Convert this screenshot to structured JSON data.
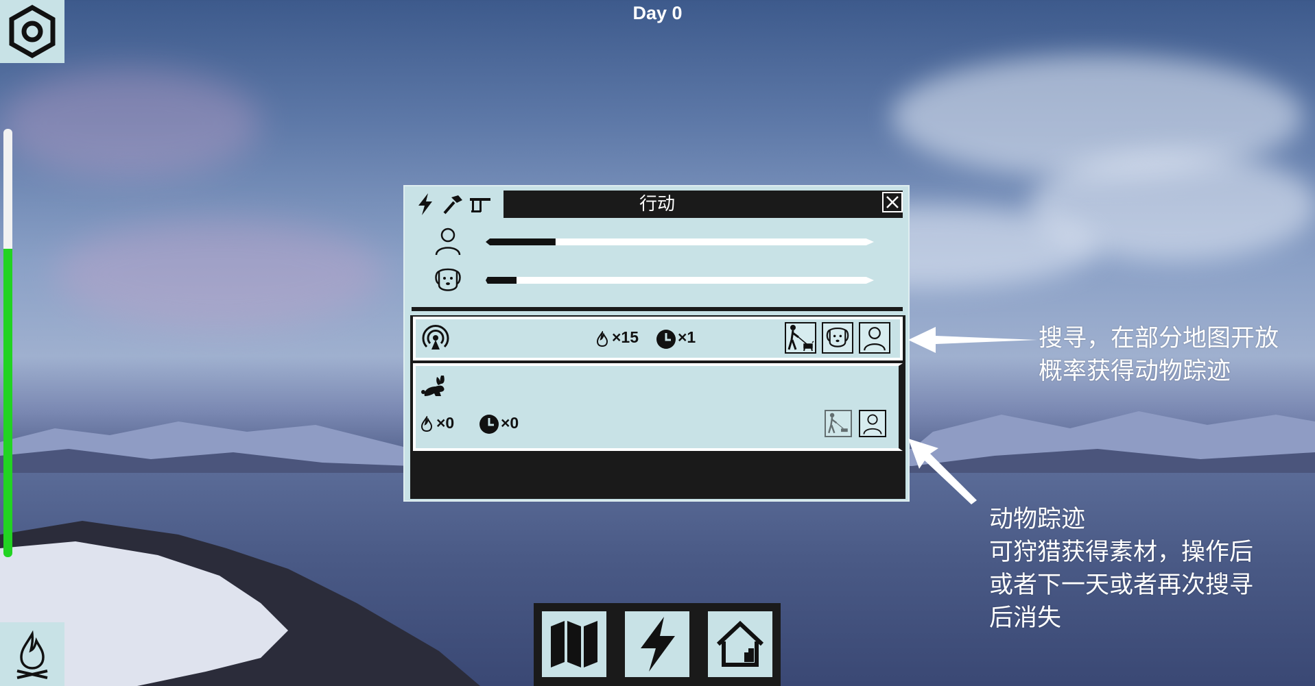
{
  "hud": {
    "day_label": "Day 0",
    "health_fraction": 0.72,
    "health_color": "#22d322"
  },
  "icons": {
    "settings": "gear-icon",
    "fire": "campfire-icon",
    "map": "map-icon",
    "action": "lightning-icon",
    "home": "home-icon"
  },
  "panel": {
    "title": "行动",
    "tabs": [
      "lightning-icon",
      "hammer-icon",
      "workbench-icon"
    ],
    "stats": [
      {
        "name": "person",
        "fill_fraction": 0.18
      },
      {
        "name": "dog",
        "fill_fraction": 0.08
      }
    ],
    "search_row": {
      "fire_cost": "×15",
      "time_cost": "×1"
    },
    "track_row": {
      "fire_cost": "×0",
      "time_cost": "×0"
    }
  },
  "annotations": {
    "search_line1": "搜寻，在部分地图开放",
    "search_line2": "概率获得动物踪迹",
    "track_line1": "动物踪迹",
    "track_line2": "可狩猎获得素材，操作后",
    "track_line3": "或者下一天或者再次搜寻",
    "track_line4": "后消失"
  }
}
